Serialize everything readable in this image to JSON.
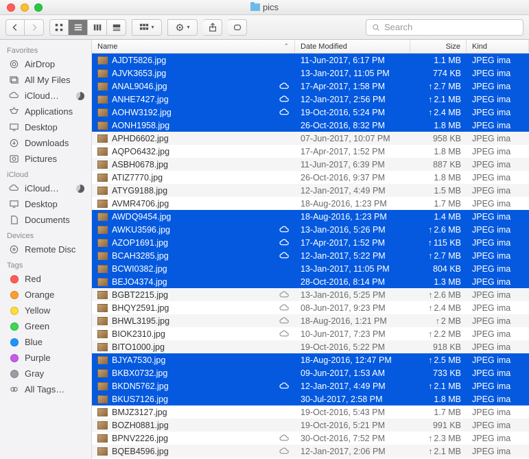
{
  "window": {
    "title": "pics"
  },
  "search": {
    "placeholder": "Search"
  },
  "columns": {
    "name": "Name",
    "date": "Date Modified",
    "size": "Size",
    "kind": "Kind"
  },
  "sidebar": {
    "sections": [
      {
        "label": "Favorites",
        "items": [
          {
            "label": "AirDrop",
            "icon": "airdrop"
          },
          {
            "label": "All My Files",
            "icon": "allfiles"
          },
          {
            "label": "iCloud…",
            "icon": "cloud",
            "pie": true
          },
          {
            "label": "Applications",
            "icon": "apps"
          },
          {
            "label": "Desktop",
            "icon": "desktop"
          },
          {
            "label": "Downloads",
            "icon": "downloads"
          },
          {
            "label": "Pictures",
            "icon": "pictures"
          }
        ]
      },
      {
        "label": "iCloud",
        "items": [
          {
            "label": "iCloud…",
            "icon": "cloud",
            "pie": true
          },
          {
            "label": "Desktop",
            "icon": "desktop"
          },
          {
            "label": "Documents",
            "icon": "documents"
          }
        ]
      },
      {
        "label": "Devices",
        "items": [
          {
            "label": "Remote Disc",
            "icon": "disc"
          }
        ]
      },
      {
        "label": "Tags",
        "items": [
          {
            "label": "Red",
            "icon": "tag",
            "color": "#ff5b53"
          },
          {
            "label": "Orange",
            "icon": "tag",
            "color": "#fe9e2f"
          },
          {
            "label": "Yellow",
            "icon": "tag",
            "color": "#fedc3a"
          },
          {
            "label": "Green",
            "icon": "tag",
            "color": "#3dd752"
          },
          {
            "label": "Blue",
            "icon": "tag",
            "color": "#1f93ff"
          },
          {
            "label": "Purple",
            "icon": "tag",
            "color": "#c65bec"
          },
          {
            "label": "Gray",
            "icon": "tag",
            "color": "#9a9ea4"
          },
          {
            "label": "All Tags…",
            "icon": "alltags"
          }
        ]
      }
    ]
  },
  "files": [
    {
      "name": "AJDT5826.jpg",
      "date": "11-Jun-2017, 6:17 PM",
      "size": "1.1 MB",
      "kind": "JPEG ima",
      "cloud": false,
      "up": false,
      "selected": true
    },
    {
      "name": "AJVK3653.jpg",
      "date": "13-Jan-2017, 11:05 PM",
      "size": "774 KB",
      "kind": "JPEG ima",
      "cloud": false,
      "up": false,
      "selected": true
    },
    {
      "name": "ANAL9046.jpg",
      "date": "17-Apr-2017, 1:58 PM",
      "size": "2.7 MB",
      "kind": "JPEG ima",
      "cloud": true,
      "up": true,
      "selected": true
    },
    {
      "name": "ANHE7427.jpg",
      "date": "12-Jan-2017, 2:56 PM",
      "size": "2.1 MB",
      "kind": "JPEG ima",
      "cloud": true,
      "up": true,
      "selected": true
    },
    {
      "name": "AOHW3192.jpg",
      "date": "19-Oct-2016, 5:24 PM",
      "size": "2.4 MB",
      "kind": "JPEG ima",
      "cloud": true,
      "up": true,
      "selected": true
    },
    {
      "name": "AONH1958.jpg",
      "date": "26-Oct-2016, 8:32 PM",
      "size": "1.8 MB",
      "kind": "JPEG ima",
      "cloud": false,
      "up": false,
      "selected": true
    },
    {
      "name": "APHD6602.jpg",
      "date": "07-Jun-2017, 10:07 PM",
      "size": "958 KB",
      "kind": "JPEG ima",
      "cloud": false,
      "up": false,
      "selected": false
    },
    {
      "name": "AQPO6432.jpg",
      "date": "17-Apr-2017, 1:52 PM",
      "size": "1.8 MB",
      "kind": "JPEG ima",
      "cloud": false,
      "up": false,
      "selected": false
    },
    {
      "name": "ASBH0678.jpg",
      "date": "11-Jun-2017, 6:39 PM",
      "size": "887 KB",
      "kind": "JPEG ima",
      "cloud": false,
      "up": false,
      "selected": false
    },
    {
      "name": "ATIZ7770.jpg",
      "date": "26-Oct-2016, 9:37 PM",
      "size": "1.8 MB",
      "kind": "JPEG ima",
      "cloud": false,
      "up": false,
      "selected": false
    },
    {
      "name": "ATYG9188.jpg",
      "date": "12-Jan-2017, 4:49 PM",
      "size": "1.5 MB",
      "kind": "JPEG ima",
      "cloud": false,
      "up": false,
      "selected": false
    },
    {
      "name": "AVMR4706.jpg",
      "date": "18-Aug-2016, 1:23 PM",
      "size": "1.7 MB",
      "kind": "JPEG ima",
      "cloud": false,
      "up": false,
      "selected": false
    },
    {
      "name": "AWDQ9454.jpg",
      "date": "18-Aug-2016, 1:23 PM",
      "size": "1.4 MB",
      "kind": "JPEG ima",
      "cloud": false,
      "up": false,
      "selected": true
    },
    {
      "name": "AWKU3596.jpg",
      "date": "13-Jan-2016, 5:26 PM",
      "size": "2.6 MB",
      "kind": "JPEG ima",
      "cloud": true,
      "up": true,
      "selected": true
    },
    {
      "name": "AZOP1691.jpg",
      "date": "17-Apr-2017, 1:52 PM",
      "size": "115 KB",
      "kind": "JPEG ima",
      "cloud": true,
      "up": true,
      "selected": true
    },
    {
      "name": "BCAH3285.jpg",
      "date": "12-Jan-2017, 5:22 PM",
      "size": "2.7 MB",
      "kind": "JPEG ima",
      "cloud": true,
      "up": true,
      "selected": true
    },
    {
      "name": "BCWI0382.jpg",
      "date": "13-Jan-2017, 11:05 PM",
      "size": "804 KB",
      "kind": "JPEG ima",
      "cloud": false,
      "up": false,
      "selected": true
    },
    {
      "name": "BEJO4374.jpg",
      "date": "28-Oct-2016, 8:14 PM",
      "size": "1.3 MB",
      "kind": "JPEG ima",
      "cloud": false,
      "up": false,
      "selected": true
    },
    {
      "name": "BGBT2215.jpg",
      "date": "13-Jan-2016, 5:25 PM",
      "size": "2.6 MB",
      "kind": "JPEG ima",
      "cloud": true,
      "up": true,
      "selected": false
    },
    {
      "name": "BHQY2591.jpg",
      "date": "08-Jun-2017, 9:23 PM",
      "size": "2.4 MB",
      "kind": "JPEG ima",
      "cloud": true,
      "up": true,
      "selected": false
    },
    {
      "name": "BHWL3195.jpg",
      "date": "18-Aug-2016, 1:21 PM",
      "size": "2 MB",
      "kind": "JPEG ima",
      "cloud": true,
      "up": true,
      "selected": false
    },
    {
      "name": "BIOK2310.jpg",
      "date": "10-Jun-2017, 7:23 PM",
      "size": "2.2 MB",
      "kind": "JPEG ima",
      "cloud": true,
      "up": true,
      "selected": false
    },
    {
      "name": "BITO1000.jpg",
      "date": "19-Oct-2016, 5:22 PM",
      "size": "918 KB",
      "kind": "JPEG ima",
      "cloud": false,
      "up": false,
      "selected": false
    },
    {
      "name": "BJYA7530.jpg",
      "date": "18-Aug-2016, 12:47 PM",
      "size": "2.5 MB",
      "kind": "JPEG ima",
      "cloud": false,
      "up": true,
      "selected": true
    },
    {
      "name": "BKBX0732.jpg",
      "date": "09-Jun-2017, 1:53 AM",
      "size": "733 KB",
      "kind": "JPEG ima",
      "cloud": false,
      "up": false,
      "selected": true
    },
    {
      "name": "BKDN5762.jpg",
      "date": "12-Jan-2017, 4:49 PM",
      "size": "2.1 MB",
      "kind": "JPEG ima",
      "cloud": true,
      "up": true,
      "selected": true
    },
    {
      "name": "BKUS7126.jpg",
      "date": "30-Jul-2017, 2:58 PM",
      "size": "1.8 MB",
      "kind": "JPEG ima",
      "cloud": false,
      "up": false,
      "selected": true
    },
    {
      "name": "BMJZ3127.jpg",
      "date": "19-Oct-2016, 5:43 PM",
      "size": "1.7 MB",
      "kind": "JPEG ima",
      "cloud": false,
      "up": false,
      "selected": false
    },
    {
      "name": "BOZH0881.jpg",
      "date": "19-Oct-2016, 5:21 PM",
      "size": "991 KB",
      "kind": "JPEG ima",
      "cloud": false,
      "up": false,
      "selected": false
    },
    {
      "name": "BPNV2226.jpg",
      "date": "30-Oct-2016, 7:52 PM",
      "size": "2.3 MB",
      "kind": "JPEG ima",
      "cloud": true,
      "up": true,
      "selected": false
    },
    {
      "name": "BQEB4596.jpg",
      "date": "12-Jan-2017, 2:06 PM",
      "size": "2.1 MB",
      "kind": "JPEG ima",
      "cloud": true,
      "up": true,
      "selected": false
    }
  ]
}
